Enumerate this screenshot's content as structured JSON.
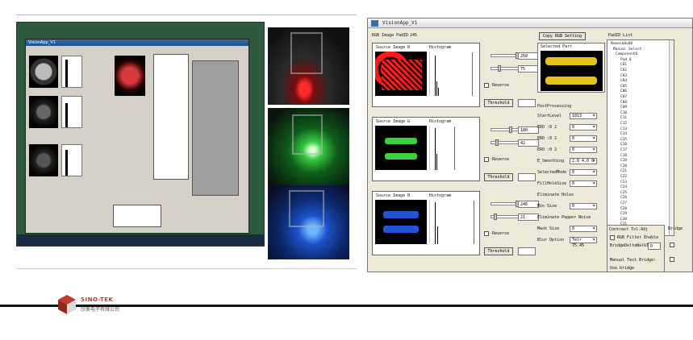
{
  "app": {
    "title": "VisionApp_V1",
    "copy_button": "Copy RGB Setting",
    "mode_label": "RGB Image PadID",
    "mode_value": "245",
    "selected_part_label": "Selected Part",
    "pad_id_list_label": "PadID List"
  },
  "sources": [
    {
      "label": "Source Image R",
      "hist_label": "Histogram",
      "v1": "250",
      "v2": "75",
      "reverse": "Reverse",
      "threshold": "Threshold"
    },
    {
      "label": "Source Image G",
      "hist_label": "Histogram",
      "v1": "180",
      "v2": "42",
      "reverse": "Reverse",
      "threshold": "Threshold"
    },
    {
      "label": "Source Image B",
      "hist_label": "Histogram",
      "v1": "246",
      "v2": "21",
      "reverse": "Reverse",
      "threshold": "Threshold"
    }
  ],
  "postproc": {
    "title": "PostProcessing",
    "rows": [
      {
        "label": "StartLevel",
        "value": "1013"
      },
      {
        "label": "ERO :0 2",
        "value": "0"
      },
      {
        "label": "ERO :0 2",
        "value": "0"
      },
      {
        "label": "ERO :0 2",
        "value": "0"
      },
      {
        "label": "E_Smoothing",
        "value": "2.0 4.0 0"
      },
      {
        "label": "SelectedMode",
        "value": "0"
      },
      {
        "label": "FillHoleSize",
        "value": "0"
      },
      {
        "label": "Eliminate Holes",
        "value": ""
      },
      {
        "label": "Min Size",
        "value": "0"
      },
      {
        "label": "Eliminate Pepper Noise",
        "value": ""
      },
      {
        "label": "Mask Size",
        "value": "0"
      },
      {
        "label": "Blur Option",
        "value": "Tetr 75.45"
      }
    ]
  },
  "contrast": {
    "title": "Contrast Tol.Adj",
    "rgb_filter": "RGB Filter Enable",
    "bridge_label": "BridgeDeltaWalkTol",
    "bridge_value": "0",
    "manual": "Manual Test Bridge:",
    "use_bridge": "Use bridge",
    "bridge_title": "Bridge"
  },
  "tree_items": [
    "Nsmesh0x00",
    "Manual Select",
    "Component0",
    "Pad_0",
    "C01",
    "C02",
    "C03",
    "C04",
    "C05",
    "C06",
    "C07",
    "C08",
    "C09",
    "C10",
    "C11",
    "C12",
    "C13",
    "C14",
    "C15",
    "C16",
    "C17",
    "C18",
    "C19",
    "C20",
    "C21",
    "C22",
    "C23",
    "C24",
    "C25",
    "C26",
    "C27",
    "C28",
    "C29",
    "C30",
    "C31",
    "C32"
  ],
  "logo": {
    "name": "SINO-TEK",
    "cn": "欣奥电子有限公司"
  }
}
